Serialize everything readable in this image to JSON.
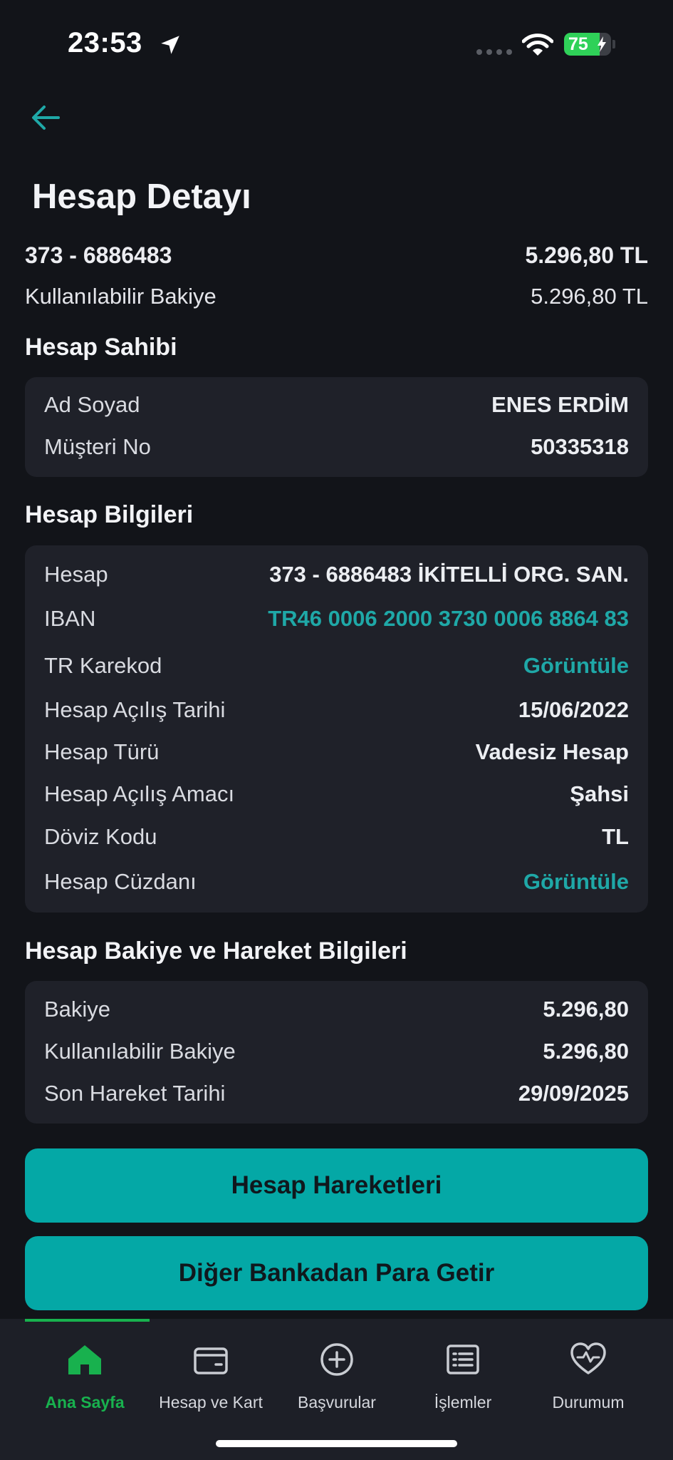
{
  "status": {
    "time": "23:53",
    "battery": "75",
    "battery_level": 0.75
  },
  "page": {
    "title": "Hesap Detayı"
  },
  "account": {
    "number": "373 - 6886483",
    "balance": "5.296,80 TL",
    "available_label": "Kullanılabilir Bakiye",
    "available_value": "5.296,80 TL"
  },
  "owner": {
    "title": "Hesap Sahibi",
    "rows": [
      {
        "label": "Ad Soyad",
        "value": "ENES ERDİM"
      },
      {
        "label": "Müşteri No",
        "value": "50335318"
      }
    ]
  },
  "info": {
    "title": "Hesap Bilgileri",
    "rows": [
      {
        "label": "Hesap",
        "value": "373 - 6886483 İKİTELLİ ORG. SAN."
      },
      {
        "label": "IBAN",
        "value": "TR46 0006 2000 3730 0006 8864 83"
      },
      {
        "label": "TR Karekod",
        "value": "Görüntüle"
      },
      {
        "label": "Hesap Açılış Tarihi",
        "value": "15/06/2022"
      },
      {
        "label": "Hesap Türü",
        "value": "Vadesiz Hesap"
      },
      {
        "label": "Hesap Açılış Amacı",
        "value": "Şahsi"
      },
      {
        "label": "Döviz Kodu",
        "value": "TL"
      },
      {
        "label": "Hesap Cüzdanı",
        "value": "Görüntüle"
      }
    ]
  },
  "movement": {
    "title": "Hesap Bakiye ve Hareket Bilgileri",
    "rows": [
      {
        "label": "Bakiye",
        "value": "5.296,80"
      },
      {
        "label": "Kullanılabilir Bakiye",
        "value": "5.296,80"
      },
      {
        "label": "Son Hareket Tarihi",
        "value": "29/09/2025"
      }
    ]
  },
  "buttons": {
    "transactions": "Hesap Hareketleri",
    "other_bank": "Diğer Bankadan Para Getir"
  },
  "tabs": [
    {
      "label": "Ana Sayfa",
      "icon": "home-icon"
    },
    {
      "label": "Hesap ve Kart",
      "icon": "wallet-icon"
    },
    {
      "label": "Başvurular",
      "icon": "plus-circle-icon"
    },
    {
      "label": "İşlemler",
      "icon": "list-icon"
    },
    {
      "label": "Durumum",
      "icon": "heart-pulse-icon"
    }
  ],
  "colors": {
    "accent": "#04a8a6",
    "link": "#1fa8a7",
    "active_tab": "#18b14e",
    "background": "#121419",
    "card": "#1f2129"
  }
}
